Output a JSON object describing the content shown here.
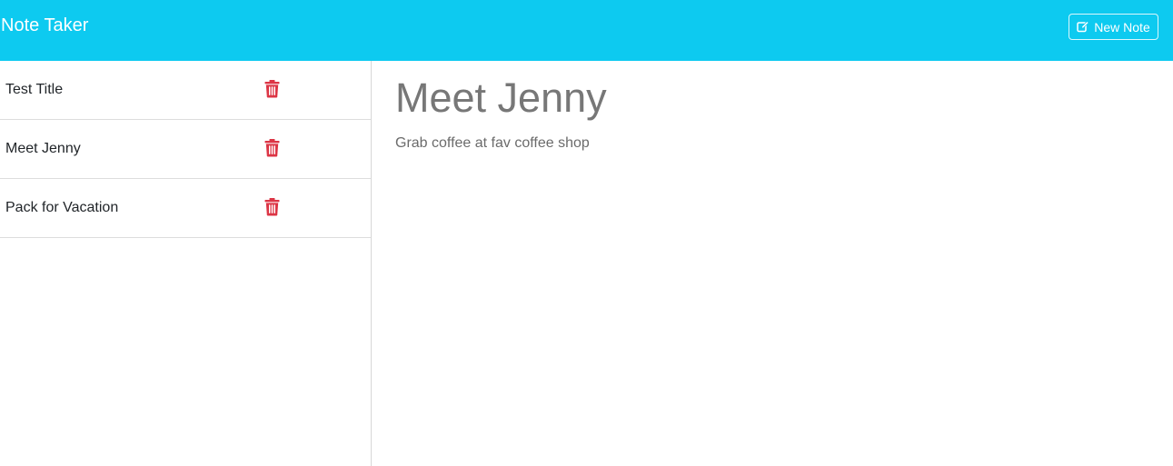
{
  "navbar": {
    "brand": "Note Taker",
    "new_note_label": "New Note",
    "new_note_icon": "edit-icon",
    "background": "#0dcaf0"
  },
  "notes": [
    {
      "title": "Test Title"
    },
    {
      "title": "Meet Jenny"
    },
    {
      "title": "Pack for Vacation"
    }
  ],
  "delete_icon": "trash-icon",
  "delete_color": "#dc3545",
  "active_note": {
    "title": "Meet Jenny",
    "text": "Grab coffee at fav coffee shop"
  }
}
